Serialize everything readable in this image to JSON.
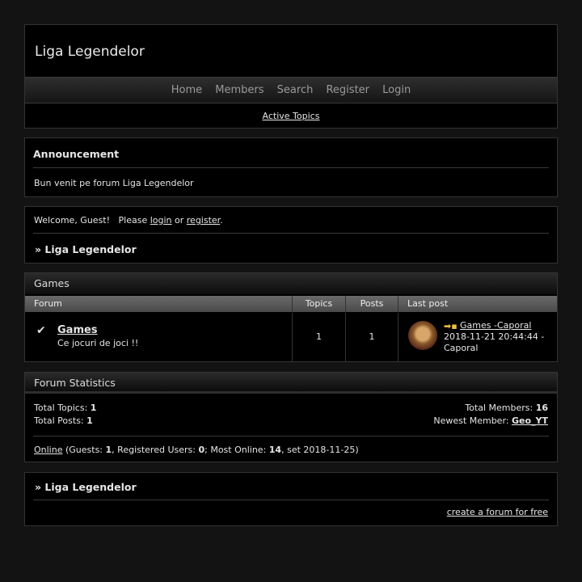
{
  "header": {
    "site_title": "Liga Legendelor",
    "nav": [
      "Home",
      "Members",
      "Search",
      "Register",
      "Login"
    ],
    "active_topics": "Active Topics"
  },
  "announcement": {
    "title": "Announcement",
    "text": "Bun venit pe forum Liga Legendelor"
  },
  "welcome": {
    "prefix": "Welcome, Guest!   Please ",
    "login": "login",
    "or": " or ",
    "register": "register",
    "suffix": ".",
    "breadcrumb": "» Liga Legendelor"
  },
  "games": {
    "category": "Games",
    "columns": {
      "forum": "Forum",
      "topics": "Topics",
      "posts": "Posts",
      "last_post": "Last post"
    },
    "row": {
      "name": "Games",
      "description": "Ce jocuri de joci !!",
      "topics": "1",
      "posts": "1",
      "last_post_title": "Games -Caporal",
      "last_post_date": "2018-11-21 20:44:44 -",
      "last_post_user": "Caporal"
    }
  },
  "stats": {
    "title": "Forum Statistics",
    "total_topics_label": "Total Topics: ",
    "total_topics": "1",
    "total_posts_label": "Total Posts: ",
    "total_posts": "1",
    "total_members_label": "Total Members: ",
    "total_members": "16",
    "newest_member_label": "Newest Member: ",
    "newest_member": "Geo_YT",
    "online_link": "Online",
    "guests_label": " (Guests: ",
    "guests": "1",
    "registered_label": ", Registered Users: ",
    "registered": "0",
    "most_online_label": "; Most Online: ",
    "most_online": "14",
    "most_online_date": ", set 2018-11-25)"
  },
  "footer": {
    "breadcrumb": "» Liga Legendelor",
    "create_forum": "create a forum for free"
  }
}
